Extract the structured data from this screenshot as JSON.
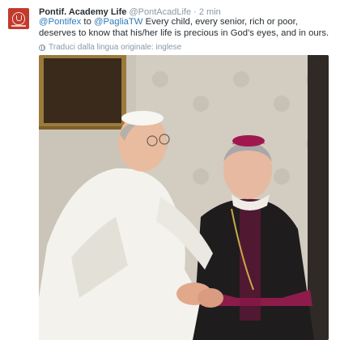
{
  "tweet": {
    "author_name": "Pontif. Academy Life",
    "author_handle": "@PontAcadLife",
    "separator": "·",
    "timestamp": "2 min",
    "mention_1": "@Pontifex",
    "text_to": " to ",
    "mention_2": "@PagliaTW",
    "text_body": " Every child, every senior, rich or poor, deserves to know that his/her life is precious in God's eyes, and in ours.",
    "translate_label": "Traduci dalla lingua originale: inglese",
    "translate_icon": "globe-icon"
  },
  "colors": {
    "avatar_bg": "#c23a2e",
    "link": "#2b7bb9",
    "muted": "#8899a6"
  }
}
